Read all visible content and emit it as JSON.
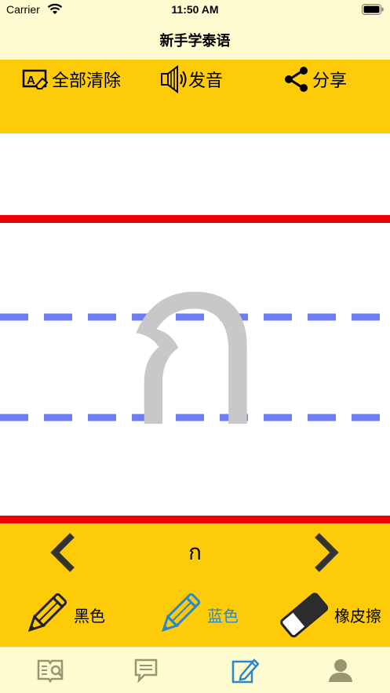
{
  "status_bar": {
    "carrier": "Carrier",
    "time": "11:50 AM"
  },
  "nav": {
    "title": "新手学泰语"
  },
  "toolbar": {
    "clear_label": "全部清除",
    "sound_label": "发音",
    "share_label": "分享"
  },
  "writing": {
    "guide_glyph": "ก"
  },
  "letter_nav": {
    "current_letter": "ก"
  },
  "pens": {
    "black_label": "黑色",
    "blue_label": "蓝色",
    "eraser_label": "橡皮擦",
    "active": "blue"
  },
  "tabs": [
    {
      "icon": "read-icon",
      "active": false
    },
    {
      "icon": "chat-icon",
      "active": false
    },
    {
      "icon": "write-icon",
      "active": true
    },
    {
      "icon": "profile-icon",
      "active": false
    }
  ],
  "colors": {
    "yellow": "#fdcb08",
    "header_bg": "#fffbd0",
    "red_line": "#ee0000",
    "blue_dash": "#6d7df2",
    "guide_glyph": "#c8c8c8",
    "active_blue": "#2b87c8"
  }
}
